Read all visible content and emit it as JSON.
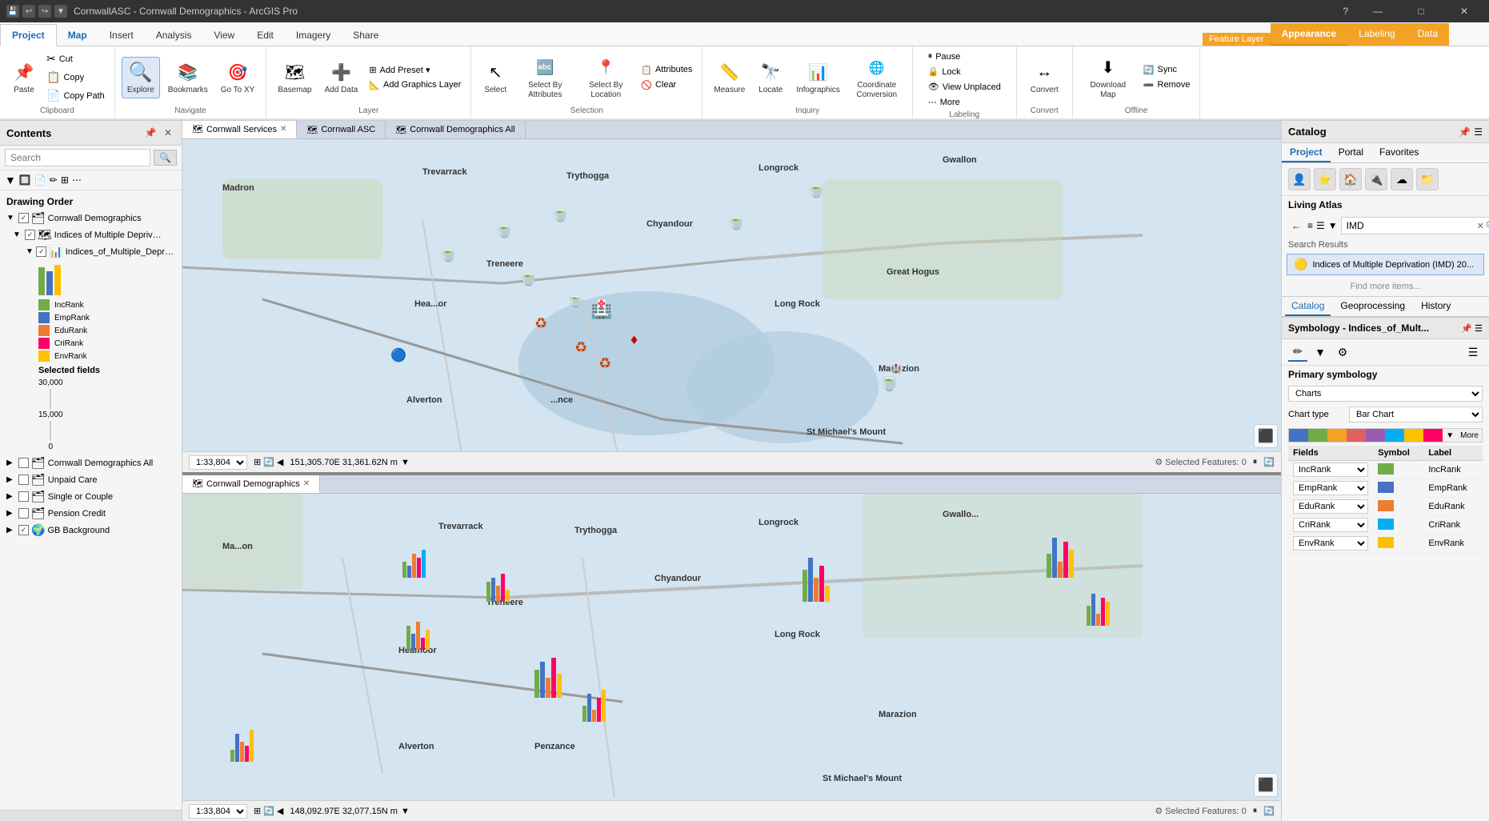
{
  "titleBar": {
    "title": "CornwallASC - Cornwall Demographics - ArcGIS Pro",
    "quickAccess": [
      "save",
      "undo",
      "redo"
    ],
    "helpBtn": "?",
    "minimizeBtn": "—",
    "restoreBtn": "□",
    "closeBtn": "✕"
  },
  "ribbon": {
    "mainTabs": [
      "Project",
      "Map",
      "Insert",
      "Analysis",
      "View",
      "Edit",
      "Imagery",
      "Share"
    ],
    "activeMainTab": "Map",
    "featureLayerLabel": "Feature Layer",
    "featureTabs": [
      "Appearance",
      "Labeling",
      "Data"
    ],
    "activeFeatureTab": "Appearance",
    "clipboard": {
      "label": "Clipboard",
      "buttons": [
        "Cut",
        "Copy",
        "Copy Path",
        "Paste"
      ]
    },
    "navigate": {
      "label": "Navigate",
      "buttons": [
        "Explore",
        "Bookmarks",
        "Go To XY"
      ]
    },
    "layer": {
      "label": "Layer",
      "buttons": [
        "Basemap",
        "Add Data",
        "Add Preset",
        "Add Graphics Layer"
      ]
    },
    "selection": {
      "label": "Selection",
      "buttons": [
        "Select",
        "Select By Attributes",
        "Select By Location",
        "Attributes",
        "Clear"
      ]
    },
    "inquiry": {
      "label": "Inquiry",
      "buttons": [
        "Measure",
        "Locate",
        "Infographics",
        "Coordinate Conversion"
      ]
    },
    "labeling": {
      "label": "Labeling",
      "buttons": [
        "Pause",
        "Lock",
        "View Unplaced",
        "More"
      ]
    },
    "convert": {
      "label": "Convert",
      "buttons": [
        "Convert"
      ]
    },
    "offline": {
      "label": "Offline",
      "buttons": [
        "Download Map",
        "Sync",
        "Remove"
      ]
    }
  },
  "leftPanel": {
    "title": "Contents",
    "searchPlaceholder": "Search",
    "searchBtn": "🔍",
    "filterLabel": "Drawing Order",
    "layers": [
      {
        "id": "cornwall-demographics",
        "label": "Cornwall Demographics",
        "checked": true,
        "expanded": true,
        "children": [
          {
            "id": "indices-multiple",
            "label": "Indices of Multiple Deprivation (I...",
            "checked": true,
            "expanded": true,
            "children": [
              {
                "id": "indices-sub",
                "label": "Indices_of_Multiple_Deprivatio...",
                "checked": true,
                "hasBarChart": true
              }
            ]
          }
        ]
      },
      {
        "id": "cornwall-demographics-all",
        "label": "Cornwall Demographics All",
        "checked": false
      },
      {
        "id": "unpaid-care",
        "label": "Unpaid Care",
        "checked": false
      },
      {
        "id": "single-couple",
        "label": "Single or Couple",
        "checked": false
      },
      {
        "id": "pension-credit",
        "label": "Pension Credit",
        "checked": false
      },
      {
        "id": "gb-background",
        "label": "GB Background",
        "checked": true
      }
    ],
    "selectedFields": {
      "label": "Selected fields",
      "scale": [
        "30,000",
        "15,000",
        "0"
      ]
    },
    "legendItems": [
      {
        "label": "IncRank",
        "color": "#70ad47"
      },
      {
        "label": "EmpRank",
        "color": "#4472c4"
      },
      {
        "label": "EduRank",
        "color": "#ed7d31"
      },
      {
        "label": "CriRank",
        "color": "#ff0066"
      },
      {
        "label": "EnvRank",
        "color": "#ffc000"
      }
    ]
  },
  "mapArea": {
    "tabs": [
      {
        "id": "cornwall-services",
        "label": "Cornwall Services",
        "closeable": true,
        "active": true
      },
      {
        "id": "cornwall-asc",
        "label": "Cornwall ASC",
        "closeable": false
      },
      {
        "id": "cornwall-demographics",
        "label": "Cornwall Demographics All",
        "closeable": false
      }
    ],
    "topMap": {
      "tabLabel": "Cornwall Services",
      "scale": "1:33,804",
      "coords": "151,305.70E 31,361.62N m",
      "selectedFeatures": "Selected Features: 0"
    },
    "bottomMap": {
      "tabLabel": "Cornwall Demographics",
      "scale": "1:33,804",
      "coords": "148,092.97E 32,077.15N m",
      "selectedFeatures": "Selected Features: 0"
    },
    "places": [
      "Madron",
      "Trevarrack",
      "Trythogga",
      "Longrock",
      "Gwallon",
      "Treneere",
      "Chyandour",
      "Heamoor",
      "Alverton",
      "Penzance",
      "Marazion",
      "St Michael's Mount",
      "Long Rock",
      "Great Hogus"
    ]
  },
  "catalogPanel": {
    "title": "Catalog",
    "headerIcons": [
      "pin",
      "close"
    ],
    "mainTabs": [
      "Project",
      "Portal",
      "Favorites"
    ],
    "icons": [
      "👤",
      "⭐",
      "🏠",
      "🔌",
      "☁",
      "📁"
    ],
    "livingAtlasLabel": "Living Atlas",
    "searchValue": "IMD",
    "searchResultsLabel": "Search Results",
    "resultItem": "Indices of Multiple Deprivation (IMD) 20...",
    "findMoreLabel": "Find more items...",
    "bottomTabs": [
      "Catalog",
      "Geoprocessing",
      "History"
    ]
  },
  "symbologyPanel": {
    "title": "Symbology - Indices_of_Mult...",
    "icons": [
      "pencil",
      "filter",
      "settings"
    ],
    "activeIcon": "pencil",
    "primarySymbLabel": "Primary symbology",
    "chartTypeLabel": "Chart type",
    "chartTypeValue": "Bar Chart",
    "primaryValue": "Charts",
    "colorStrip": [
      "#4472c4",
      "#70ad47",
      "#f4a225",
      "#e06060",
      "#9b59b6",
      "#00b0f0",
      "#ffc000",
      "#ff0066"
    ],
    "moreBtn": "More",
    "tableHeaders": [
      "Fields",
      "Symbol",
      "Label"
    ],
    "tableRows": [
      {
        "field": "IncRank",
        "color": "#70ad47",
        "label": "IncRank"
      },
      {
        "field": "EmpRank",
        "color": "#4472c4",
        "label": "EmpRank"
      },
      {
        "field": "EduRank",
        "color": "#ed7d31",
        "label": "EduRank"
      },
      {
        "field": "CriRank",
        "color": "#00b0f0",
        "label": "CriRank"
      },
      {
        "field": "EnvRank",
        "color": "#ffc000",
        "label": "EnvRank"
      }
    ]
  },
  "icons": {
    "save": "💾",
    "undo": "↩",
    "redo": "↪",
    "cut": "✂",
    "copy": "📋",
    "paste": "📌",
    "explore": "🔍",
    "bookmark": "🔖",
    "goto": "📍",
    "basemap": "🗺",
    "adddata": "➕",
    "select": "↖",
    "measure": "📏",
    "locate": "🔭",
    "info": "📊",
    "pause": "⏸",
    "lock": "🔒",
    "download": "⬇",
    "sync": "🔄",
    "convert": "↔",
    "back": "←",
    "forward": "→",
    "sort": "≡",
    "filter": "▼"
  }
}
